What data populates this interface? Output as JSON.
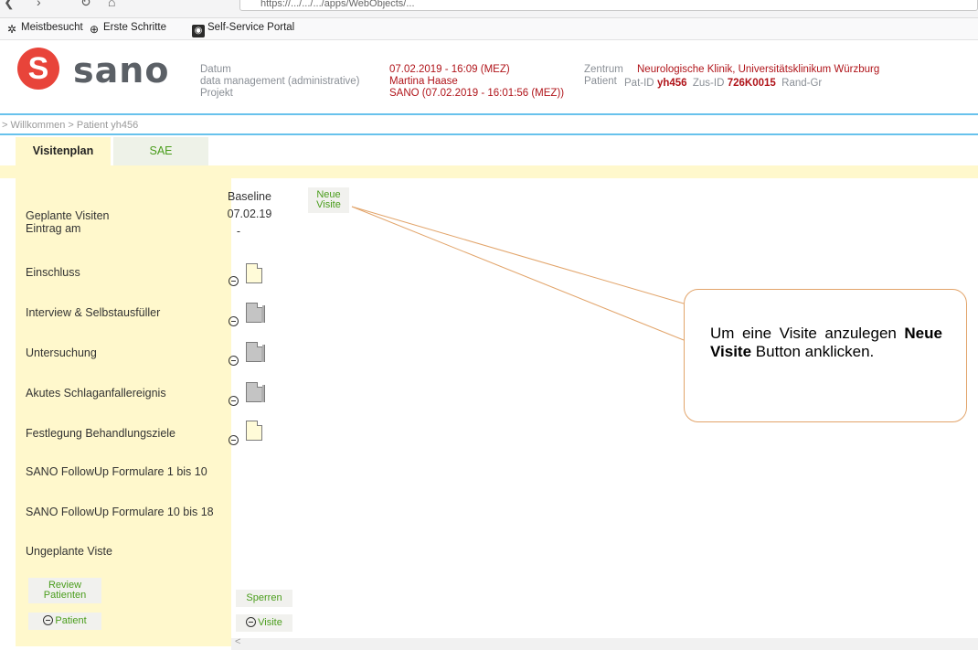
{
  "browser": {
    "url_fragment": "https://.../.../.../apps/WebObjects/...",
    "bookmarks": [
      "Meistbesucht",
      "Erste Schritte",
      "Self-Service Portal"
    ]
  },
  "header": {
    "logo_text": "sano",
    "labels": {
      "datum": "Datum",
      "role": "data management (administrative)",
      "projekt": "Projekt",
      "zentrum": "Zentrum",
      "patient": "Patient"
    },
    "datum_value": "07.02.2019 - 16:09 (MEZ)",
    "user_value": "Martina Haase",
    "projekt_value": "SANO (07.02.2019 - 16:01:56 (MEZ))",
    "zentrum_value": "Neurologische Klinik, Universitätsklinikum Würzburg",
    "patient_parts": {
      "pat_id_label": "Pat-ID",
      "pat_id": "yh456",
      "zus_id_label": "Zus-ID",
      "zus_id": "726K0015",
      "rand_label": "Rand-Gr"
    }
  },
  "breadcrumb": "> Willkommen   > Patient yh456",
  "tabs": [
    {
      "label": "Visitenplan",
      "active": true
    },
    {
      "label": "SAE",
      "active": false
    }
  ],
  "visit_plan": {
    "header_labels": [
      "Geplante Visiten",
      "Eintrag am"
    ],
    "baseline_title": "Baseline",
    "baseline_date": "07.02.19",
    "baseline_dash": "-",
    "new_visit_label": [
      "Neue",
      "Visite"
    ],
    "rows": [
      {
        "label": "Einschluss",
        "doc": "yellow"
      },
      {
        "label": "Interview & Selbstausfüller",
        "doc": "grey"
      },
      {
        "label": "Untersuchung",
        "doc": "grey"
      },
      {
        "label": "Akutes Schlaganfallereignis",
        "doc": "grey"
      },
      {
        "label": "Festlegung Behandlungsziele",
        "doc": "yellow"
      },
      {
        "label": "SANO FollowUp Formulare 1 bis 10",
        "doc": null
      },
      {
        "label": "SANO FollowUp Formulare 10 bis 18",
        "doc": null
      },
      {
        "label": "Ungeplante Viste",
        "doc": null
      }
    ],
    "review_label": [
      "Review",
      "Patienten"
    ],
    "sperren_label": "Sperren",
    "patient_label": "Patient",
    "visite_label": "Visite"
  },
  "callout": {
    "text_pre": "Um eine Visite anzulegen",
    "text_bold": "Neue Visite",
    "text_post": "Button anklicken."
  },
  "colors": {
    "accent_green": "#4a9d1c",
    "brand_red": "#e8443a",
    "value_red": "#b0141a",
    "highlight_yellow": "#fff8cc",
    "rule_blue": "#68c2ec",
    "callout_border": "#e2a46a"
  }
}
